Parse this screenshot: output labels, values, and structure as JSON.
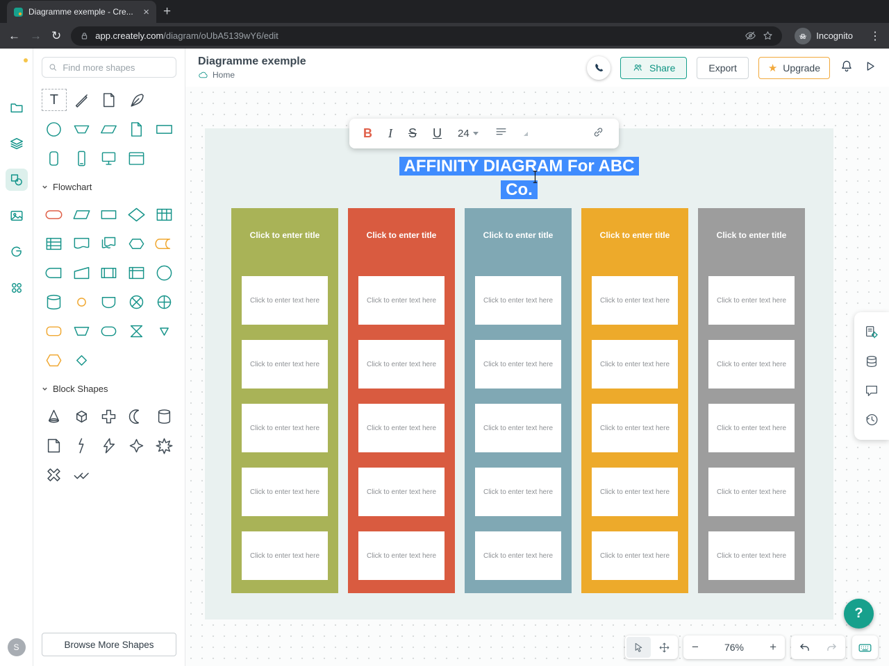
{
  "browser": {
    "tab_title": "Diagramme exemple - Cre...",
    "close_glyph": "×",
    "new_tab_glyph": "+",
    "back_glyph": "←",
    "forward_glyph": "→",
    "reload_glyph": "↻",
    "url_host": "app.creately.com",
    "url_path": "/diagram/oUbA5139wY6/edit",
    "incognito_label": "Incognito",
    "menu_glyph": "⋮"
  },
  "rail": {
    "avatar_initial": "S"
  },
  "panel": {
    "search_placeholder": "Find more shapes",
    "text_tool_glyph": "T",
    "flowchart_section": "Flowchart",
    "block_section": "Block Shapes",
    "browse_more": "Browse More Shapes"
  },
  "header": {
    "doc_title": "Diagramme exemple",
    "breadcrumb_home": "Home",
    "share": "Share",
    "export": "Export",
    "upgrade": "Upgrade"
  },
  "text_toolbar": {
    "bold": "B",
    "italic": "I",
    "strikethrough": "S",
    "underline": "U",
    "font_size": "24"
  },
  "diagram": {
    "title_line1": "AFFINITY DIAGRAM For ABC",
    "title_line2": "Co.",
    "column_title_placeholder": "Click to enter title",
    "card_placeholder": "Click to enter text here",
    "cards_per_column": 5,
    "column_colors": [
      "#a9b357",
      "#d95b40",
      "#80a8b4",
      "#edaa2b",
      "#9d9d9d"
    ]
  },
  "controls": {
    "zoom_level": "76%",
    "zoom_out_glyph": "−",
    "zoom_in_glyph": "+",
    "help_glyph": "?"
  },
  "colors": {
    "accent": "#17a08c",
    "selection": "#3f8cfe",
    "upgrade": "#f2a93c"
  }
}
